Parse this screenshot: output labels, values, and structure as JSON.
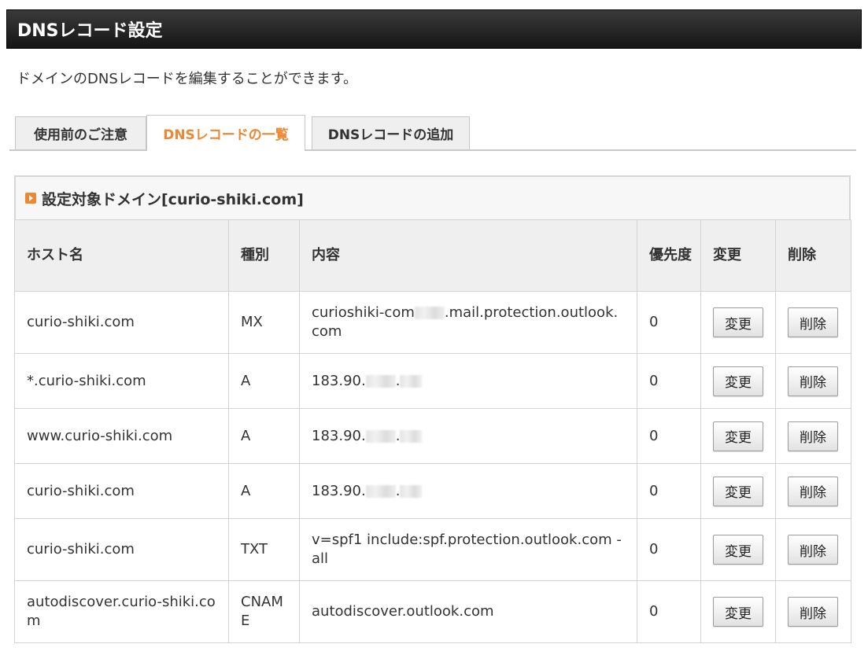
{
  "page": {
    "title": "DNSレコード設定",
    "description": "ドメインのDNSレコードを編集することができます。"
  },
  "tabs": [
    {
      "label": "使用前のご注意",
      "active": false
    },
    {
      "label": "DNSレコードの一覧",
      "active": true
    },
    {
      "label": "DNSレコードの追加",
      "active": false
    }
  ],
  "panel": {
    "heading": "設定対象ドメイン[curio-shiki.com]"
  },
  "table": {
    "headers": {
      "host": "ホスト名",
      "type": "種別",
      "content": "内容",
      "priority": "優先度",
      "edit": "変更",
      "delete": "削除"
    },
    "rows": [
      {
        "host": "curio-shiki.com",
        "type": "MX",
        "content_pre": "curioshiki-com",
        "content_post": ".mail.protection.outlook.com",
        "priority": "0",
        "edit": "変更",
        "delete": "削除"
      },
      {
        "host": "*.curio-shiki.com",
        "type": "A",
        "content_pre": "183.90.",
        "content_post": ".",
        "priority": "0",
        "edit": "変更",
        "delete": "削除"
      },
      {
        "host": "www.curio-shiki.com",
        "type": "A",
        "content_pre": "183.90.",
        "content_post": ".",
        "priority": "0",
        "edit": "変更",
        "delete": "削除"
      },
      {
        "host": "curio-shiki.com",
        "type": "A",
        "content_pre": "183.90.",
        "content_post": ".",
        "priority": "0",
        "edit": "変更",
        "delete": "削除"
      },
      {
        "host": "curio-shiki.com",
        "type": "TXT",
        "content_pre": "v=spf1 include:spf.protection.outlook.com -all",
        "content_post": "",
        "priority": "0",
        "edit": "変更",
        "delete": "削除"
      },
      {
        "host": "autodiscover.curio-shiki.com",
        "type": "CNAME",
        "content_pre": "autodiscover.outlook.com",
        "content_post": "",
        "priority": "0",
        "edit": "変更",
        "delete": "削除"
      }
    ]
  },
  "colors": {
    "accent": "#f0862f",
    "title_bar": "#222222",
    "header_bg": "#efefef"
  }
}
